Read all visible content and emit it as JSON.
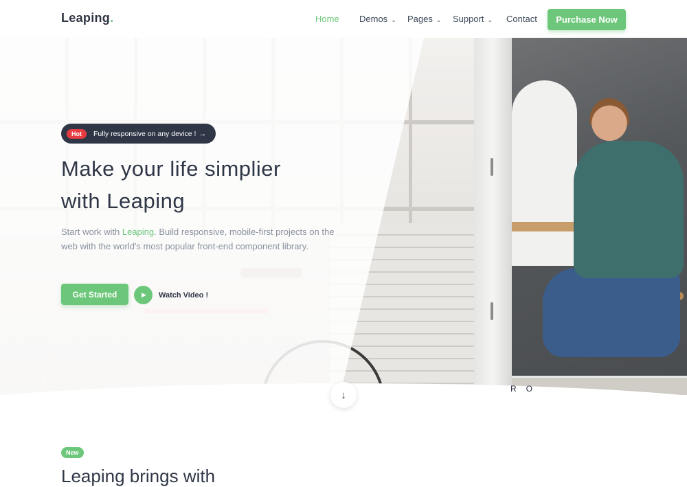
{
  "navbar": {
    "logo_text": "Leaping",
    "logo_dot": ".",
    "links": [
      {
        "label": "Home",
        "active": true,
        "dropdown": false
      },
      {
        "label": "Demos",
        "active": false,
        "dropdown": true
      },
      {
        "label": "Pages",
        "active": false,
        "dropdown": true
      },
      {
        "label": "Support",
        "active": false,
        "dropdown": true
      },
      {
        "label": "Contact",
        "active": false,
        "dropdown": false
      }
    ],
    "cta_label": "Purchase Now"
  },
  "hero": {
    "pill": {
      "badge": "Hot",
      "text": "Fully responsive on any device !",
      "icon": "arrow-right-icon"
    },
    "title_line1": "Make your life simplier",
    "title_line2": "with Leaping",
    "desc_before": "Start work with ",
    "desc_brand": "Leaping",
    "desc_after": ". Build responsive, mobile-first projects on the web with the world's most popular front-end component library.",
    "primary_button": "Get Started",
    "video_label": "Watch Video !",
    "play_icon": "play-icon",
    "scroll_icon": "arrow-down-icon",
    "room_letters": "RO"
  },
  "features": {
    "badge": "New",
    "title": "Leaping brings with"
  },
  "colors": {
    "accent": "#6dc77a",
    "dark": "#2f3646",
    "hot": "#e53c42",
    "muted_text": "#8a919e"
  }
}
